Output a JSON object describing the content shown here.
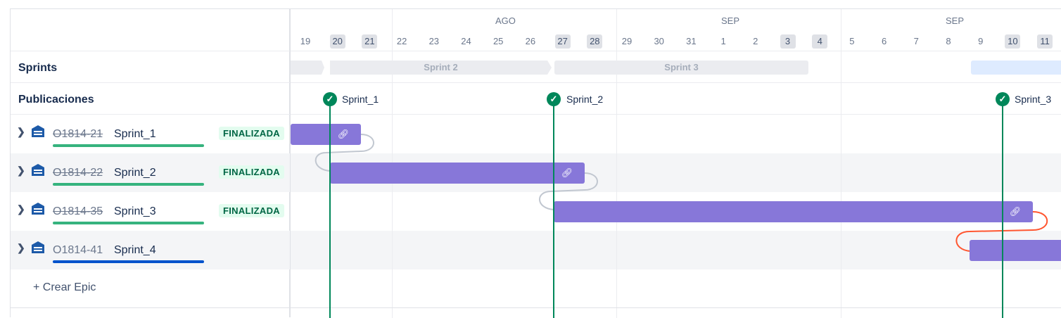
{
  "left": {
    "rows": {
      "sprints": "Sprints",
      "publicaciones": "Publicaciones"
    },
    "epics": [
      {
        "key": "O1814-21",
        "name": "Sprint_1",
        "status": "FINALIZADA",
        "done": true,
        "bar_color": "#36b37e"
      },
      {
        "key": "O1814-22",
        "name": "Sprint_2",
        "status": "FINALIZADA",
        "done": true,
        "bar_color": "#36b37e"
      },
      {
        "key": "O1814-35",
        "name": "Sprint_3",
        "status": "FINALIZADA",
        "done": true,
        "bar_color": "#36b37e"
      },
      {
        "key": "O1814-41",
        "name": "Sprint_4",
        "status": "",
        "done": false,
        "bar_color": "#0052cc"
      }
    ],
    "create_epic": "+ Crear Epic",
    "icons": {
      "expand": "chevron-right-icon",
      "epic": "epic-truck-icon",
      "add": "plus-icon"
    }
  },
  "timeline": {
    "months": [
      "AGO",
      "SEP",
      "SEP"
    ],
    "days": [
      {
        "d": "19",
        "weekend": false
      },
      {
        "d": "20",
        "weekend": true
      },
      {
        "d": "21",
        "weekend": true
      },
      {
        "d": "22",
        "weekend": false
      },
      {
        "d": "23",
        "weekend": false
      },
      {
        "d": "24",
        "weekend": false
      },
      {
        "d": "25",
        "weekend": false
      },
      {
        "d": "26",
        "weekend": false
      },
      {
        "d": "27",
        "weekend": true
      },
      {
        "d": "28",
        "weekend": true
      },
      {
        "d": "29",
        "weekend": false
      },
      {
        "d": "30",
        "weekend": false
      },
      {
        "d": "31",
        "weekend": false
      },
      {
        "d": "1",
        "weekend": false
      },
      {
        "d": "2",
        "weekend": false
      },
      {
        "d": "3",
        "weekend": true
      },
      {
        "d": "4",
        "weekend": true
      },
      {
        "d": "5",
        "weekend": false
      },
      {
        "d": "6",
        "weekend": false
      },
      {
        "d": "7",
        "weekend": false
      },
      {
        "d": "8",
        "weekend": false
      },
      {
        "d": "9",
        "weekend": false
      },
      {
        "d": "10",
        "weekend": true
      },
      {
        "d": "11",
        "weekend": true
      }
    ],
    "sprints": [
      "Sprint 2",
      "Sprint 3"
    ],
    "releases": [
      "Sprint_1",
      "Sprint_2",
      "Sprint_3"
    ],
    "colors": {
      "bar": "#8777d9",
      "release": "#00875a",
      "dependency": "#c1c7d0",
      "dependency_conflict": "#ff5630",
      "lozenge_bg": "#e3fcef",
      "lozenge_text": "#006644"
    }
  }
}
